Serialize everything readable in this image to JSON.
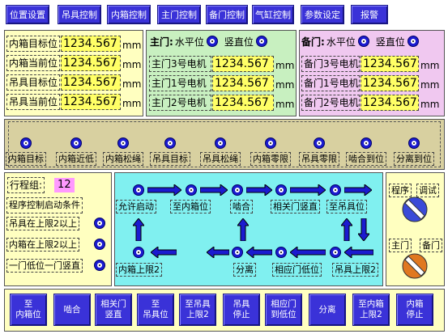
{
  "top_nav": [
    "位置设置",
    "吊具控制",
    "内箱控制",
    "主门控制",
    "备门控制",
    "气缸控制",
    "参数设定",
    "报警"
  ],
  "unit": "mm",
  "inner_box": [
    {
      "label": "内箱目标位",
      "value": "1234.567"
    },
    {
      "label": "内箱当前位",
      "value": "1234.567"
    },
    {
      "label": "吊具目标位",
      "value": "1234.567"
    },
    {
      "label": "吊具当前位",
      "value": "1234.567"
    }
  ],
  "main_door": {
    "title": "主门:",
    "horizontal": "水平位",
    "vertical": "竖直位",
    "rows": [
      {
        "label": "主门3号电机",
        "value": "1234.567"
      },
      {
        "label": "主门1号电机",
        "value": "1234.567"
      },
      {
        "label": "主门2号电机",
        "value": "1234.567"
      }
    ]
  },
  "backup_door": {
    "title": "备门:",
    "horizontal": "水平位",
    "vertical": "竖直位",
    "rows": [
      {
        "label": "备门3号电机",
        "value": "1234.567"
      },
      {
        "label": "备门1号电机",
        "value": "1234.567"
      },
      {
        "label": "备门2号电机",
        "value": "1234.567"
      }
    ]
  },
  "indicators": [
    "内箱目标",
    "内箱近低",
    "内箱松绳",
    "吊具目标",
    "吊具松绳",
    "内箱零限",
    "吊具零限",
    "啮合到位",
    "分离到位"
  ],
  "stroke": {
    "group_label": "行程组:",
    "group_value": "12",
    "conditions_title": "程序控制启动条件",
    "conditions": [
      "吊具在上限2以上",
      "内箱在上限2以上",
      "一门低位一门竖直"
    ]
  },
  "flow": [
    "允许启动",
    "至内箱位",
    "啮合",
    "相关门竖直",
    "至吊具位",
    "内箱上限2",
    "分离",
    "相应门低位",
    "吊具上限2"
  ],
  "mode": {
    "program": "程序",
    "debug": "调试",
    "main": "主门",
    "backup": "备门"
  },
  "bottom_buttons": [
    "至\n内箱位",
    "啮合",
    "相关门\n竖直",
    "至\n吊具位",
    "至吊具\n上限2",
    "吊具\n停止",
    "相应门\n到低位",
    "分离",
    "至内箱\n上限2",
    "内箱\n停止"
  ],
  "colors": {
    "button": "#3a32d8",
    "inner_panel": "#ffffc0",
    "main_panel": "#c8f0c0",
    "backup_panel": "#f0c8f0",
    "indicator_panel": "#d8d0a0",
    "flow_panel": "#80f0f0",
    "value_bg": "#ffff66",
    "indicator": "#1b1bd0"
  }
}
